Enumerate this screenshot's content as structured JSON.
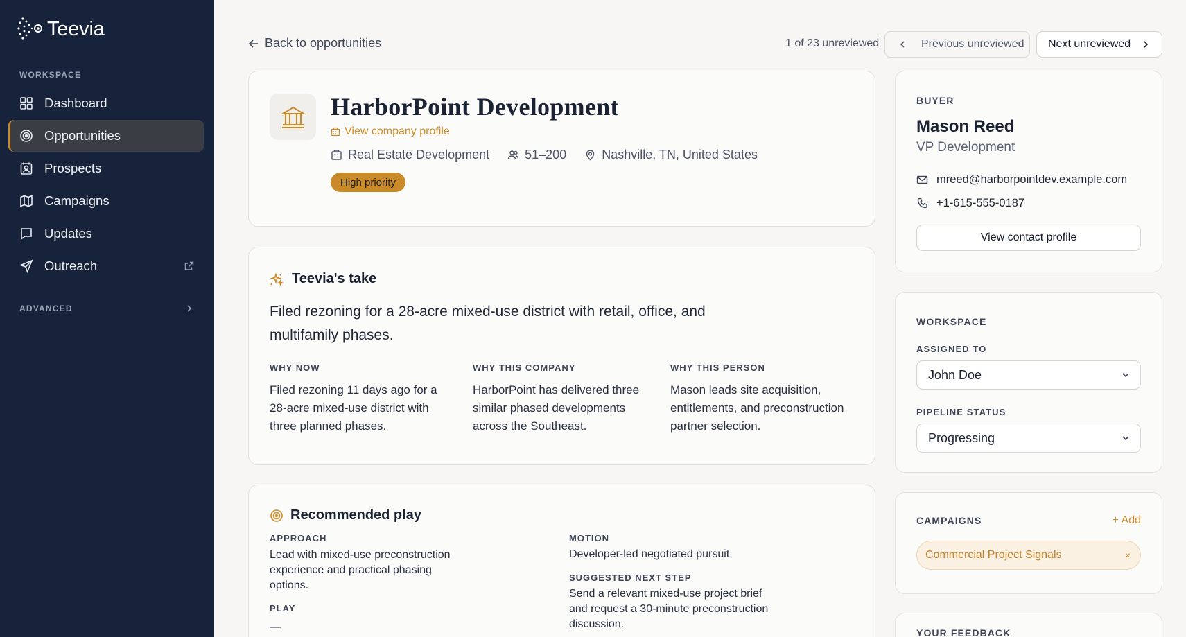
{
  "app": {
    "name": "Teevia"
  },
  "sidebar": {
    "workspace_label": "WORKSPACE",
    "items": [
      {
        "label": "Dashboard",
        "icon": "dashboard-icon"
      },
      {
        "label": "Opportunities",
        "icon": "target-icon",
        "active": true
      },
      {
        "label": "Prospects",
        "icon": "prospects-icon"
      },
      {
        "label": "Campaigns",
        "icon": "map-icon"
      },
      {
        "label": "Updates",
        "icon": "message-icon"
      },
      {
        "label": "Outreach",
        "icon": "send-icon",
        "external": true
      }
    ],
    "advanced_label": "ADVANCED"
  },
  "topbar": {
    "back_label": "Back to opportunities",
    "counter": "1 of 23 unreviewed",
    "prev_label": "Previous unreviewed",
    "next_label": "Next unreviewed"
  },
  "company": {
    "name": "HarborPoint Development",
    "profile_link": "View company profile",
    "industry": "Real Estate Development",
    "size": "51–200",
    "location": "Nashville, TN, United States",
    "priority": "High priority"
  },
  "take": {
    "title": "Teevia's take",
    "summary": "Filed rezoning for a 28-acre mixed-use district with retail, office, and multifamily phases.",
    "why_now_label": "WHY NOW",
    "why_now": "Filed rezoning 11 days ago for a 28-acre mixed-use district with three planned phases.",
    "why_company_label": "WHY THIS COMPANY",
    "why_company": "HarborPoint has delivered three similar phased developments across the Southeast.",
    "why_person_label": "WHY THIS PERSON",
    "why_person": "Mason leads site acquisition, entitlements, and preconstruction partner selection."
  },
  "play": {
    "title": "Recommended play",
    "approach_label": "APPROACH",
    "approach": "Lead with mixed-use preconstruction experience and practical phasing options.",
    "play_label": "PLAY",
    "play_value": "—",
    "motion_label": "MOTION",
    "motion": "Developer-led negotiated pursuit",
    "next_step_label": "SUGGESTED NEXT STEP",
    "next_step": "Send a relevant mixed-use project brief and request a 30-minute preconstruction discussion."
  },
  "buyer": {
    "label": "BUYER",
    "name": "Mason Reed",
    "title": "VP Development",
    "email": "mreed@harborpointdev.example.com",
    "phone": "+1-615-555-0187",
    "button": "View contact profile"
  },
  "workspace": {
    "label": "WORKSPACE",
    "assigned_label": "ASSIGNED TO",
    "assigned_value": "John Doe",
    "status_label": "PIPELINE STATUS",
    "status_value": "Progressing"
  },
  "campaigns": {
    "label": "CAMPAIGNS",
    "add_label": "+ Add",
    "tag": "Commercial Project Signals",
    "remove": "×"
  },
  "feedback": {
    "label": "YOUR FEEDBACK"
  },
  "colors": {
    "sidebar": "#17233a",
    "accent": "#c98a2a",
    "background": "#f7f6f4"
  }
}
